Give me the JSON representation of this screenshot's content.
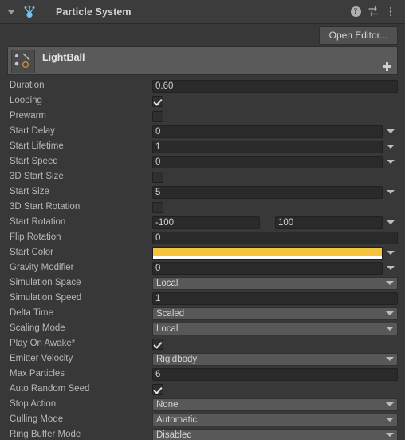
{
  "header": {
    "title": "Particle System",
    "foldout_icon": "triangle-down-icon",
    "component_icon": "particle-system-icon",
    "help_icon": "?",
    "preset_icon": "preset-sliders-icon",
    "menu_icon": "kebab-menu-icon"
  },
  "toolbar": {
    "open_editor_label": "Open Editor..."
  },
  "emitter": {
    "name": "LightBall",
    "thumbnail_icon": "particle-thumbnail-icon",
    "add_icon": "plus-icon"
  },
  "colors": {
    "start_color_rgb": "#F5C33C",
    "start_color_alpha": "#FFFFFF",
    "panel_bg": "#383838",
    "field_bg": "#2A2A2A",
    "popup_bg": "#585858",
    "label_text": "#B7B7B7"
  },
  "properties": [
    {
      "label": "Duration",
      "type": "number",
      "value": "0.60",
      "dropdown": false
    },
    {
      "label": "Looping",
      "type": "checkbox",
      "checked": true
    },
    {
      "label": "Prewarm",
      "type": "checkbox",
      "checked": false
    },
    {
      "label": "Start Delay",
      "type": "number",
      "value": "0",
      "dropdown": true
    },
    {
      "label": "Start Lifetime",
      "type": "number",
      "value": "1",
      "dropdown": true
    },
    {
      "label": "Start Speed",
      "type": "number",
      "value": "0",
      "dropdown": true
    },
    {
      "label": "3D Start Size",
      "type": "checkbox",
      "checked": false
    },
    {
      "label": "Start Size",
      "type": "number",
      "value": "5",
      "dropdown": true
    },
    {
      "label": "3D Start Rotation",
      "type": "checkbox",
      "checked": false
    },
    {
      "label": "Start Rotation",
      "type": "dual",
      "value_min": "-100",
      "value_max": "100",
      "dropdown": true
    },
    {
      "label": "Flip Rotation",
      "type": "number",
      "value": "0",
      "dropdown": false
    },
    {
      "label": "Start Color",
      "type": "color",
      "value": "#F5C33C",
      "dropdown": true
    },
    {
      "label": "Gravity Modifier",
      "type": "number",
      "value": "0",
      "dropdown": true
    },
    {
      "label": "Simulation Space",
      "type": "popup",
      "value": "Local"
    },
    {
      "label": "Simulation Speed",
      "type": "number",
      "value": "1",
      "dropdown": false
    },
    {
      "label": "Delta Time",
      "type": "popup",
      "value": "Scaled"
    },
    {
      "label": "Scaling Mode",
      "type": "popup",
      "value": "Local"
    },
    {
      "label": "Play On Awake*",
      "type": "checkbox",
      "checked": true
    },
    {
      "label": "Emitter Velocity",
      "type": "popup",
      "value": "Rigidbody"
    },
    {
      "label": "Max Particles",
      "type": "number",
      "value": "6",
      "dropdown": false
    },
    {
      "label": "Auto Random Seed",
      "type": "checkbox",
      "checked": true
    },
    {
      "label": "Stop Action",
      "type": "popup",
      "value": "None"
    },
    {
      "label": "Culling Mode",
      "type": "popup",
      "value": "Automatic"
    },
    {
      "label": "Ring Buffer Mode",
      "type": "popup",
      "value": "Disabled"
    }
  ]
}
